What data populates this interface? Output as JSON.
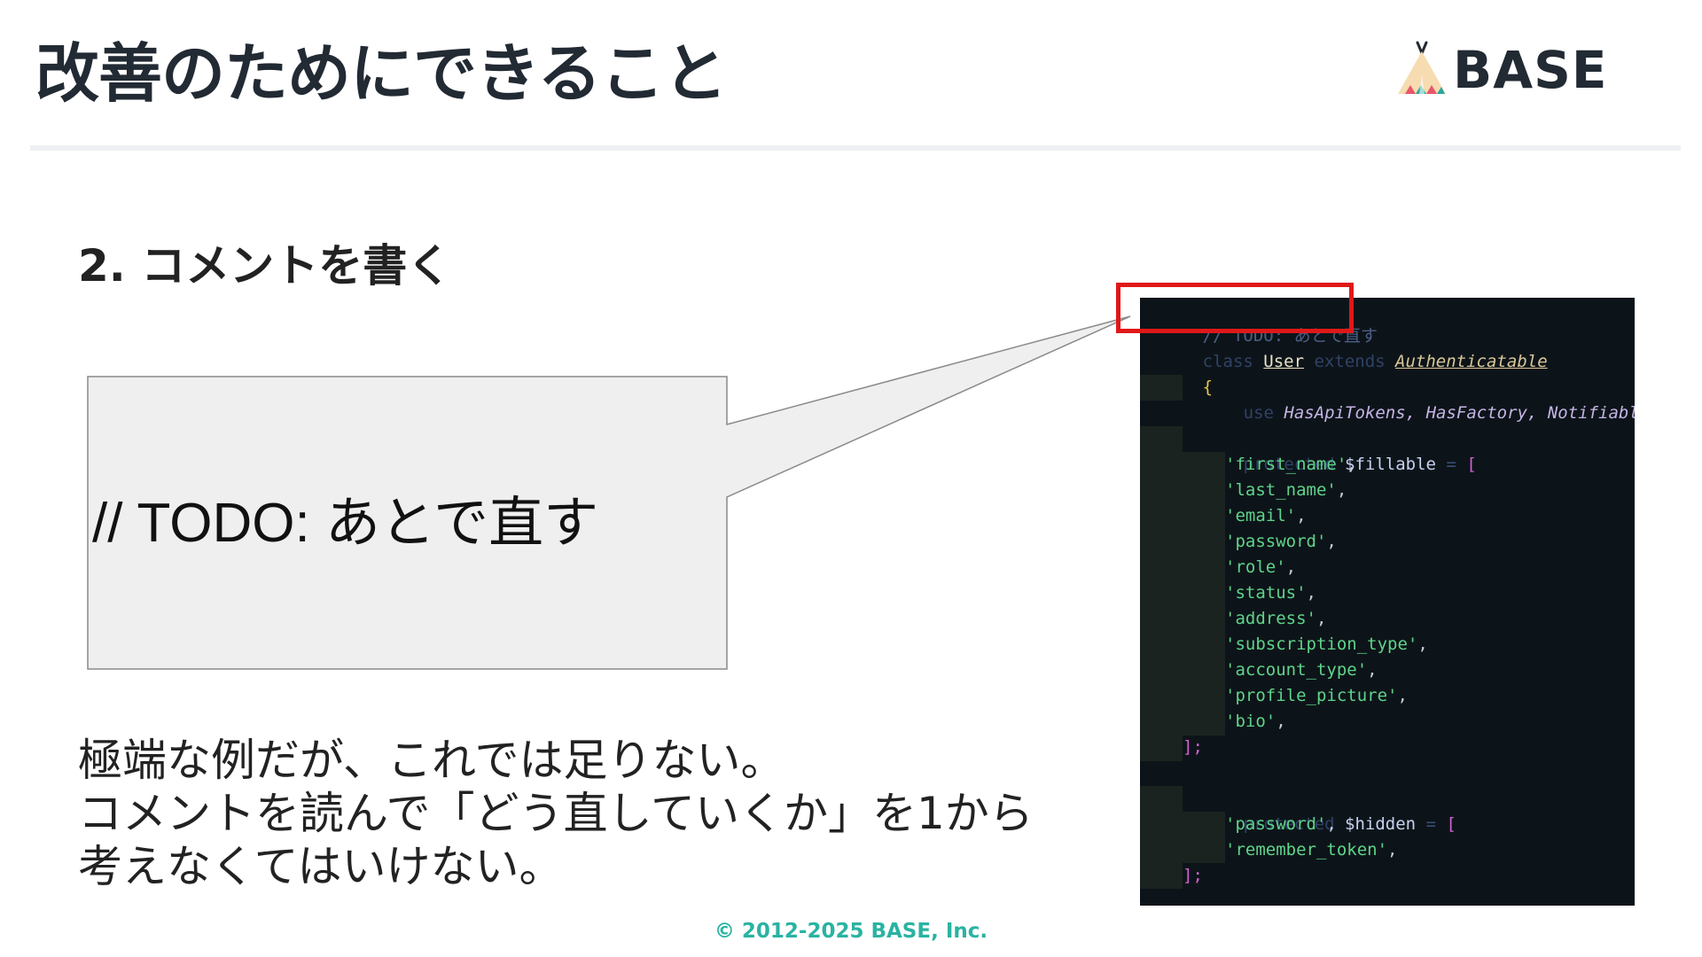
{
  "slide": {
    "title": "改善のためにできること",
    "logo_text": "BASE",
    "section_heading": "2. コメントを書く",
    "callout_text": "// TODO: あとで直す",
    "body_lines": [
      "極端な例だが、これでは足りない。",
      "コメントを読んで「どう直していくか」を1から",
      "考えなくてはいけない。"
    ],
    "footer": "© 2012-2025 BASE, Inc."
  },
  "code": {
    "comment": "// TODO: あとで直す",
    "class_kw": "class",
    "class_name": "User",
    "extends_kw": "extends",
    "parent_class": "Authenticatable",
    "open_brace": "{",
    "use_kw": "use",
    "traits": "HasApiTokens, HasFactory, Notifiable",
    "protected_kw": "protected",
    "fillable_var": "$fillable",
    "hidden_var": "$hidden",
    "fillable_items": [
      "'first_name'",
      "'last_name'",
      "'email'",
      "'password'",
      "'role'",
      "'status'",
      "'address'",
      "'subscription_type'",
      "'account_type'",
      "'profile_picture'",
      "'bio'"
    ],
    "hidden_items": [
      "'password'",
      "'remember_token'"
    ],
    "array_close": "];"
  },
  "colors": {
    "title": "#222a33",
    "footer_accent": "#2ab3a2",
    "highlight_border": "#e01818",
    "code_background": "#0d1419",
    "callout_fill": "#efefef"
  },
  "icons": {
    "logo": "tepee-logo-icon"
  }
}
